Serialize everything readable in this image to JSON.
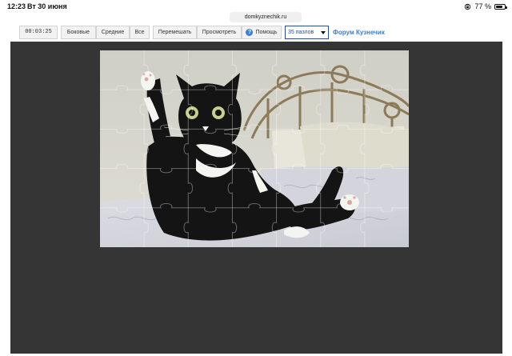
{
  "status_bar": {
    "time": "12:23",
    "date": "Вт 30 июня",
    "battery": "77 %",
    "battery_level": 0.77
  },
  "browser": {
    "url": "domkyznechik.ru"
  },
  "toolbar": {
    "timer": "00:03:25",
    "sides_label": "Боковые",
    "middle_label": "Средние",
    "all_label": "Все",
    "shuffle_label": "Перемешать",
    "preview_label": "Просмотреть",
    "help_label": "Помощь",
    "pieces_selected": "35 пазлов",
    "forum_link": "Форум Кузнечик"
  },
  "colors": {
    "board_bg": "#353535",
    "link": "#3b7fd6",
    "select_border": "#2b4f86"
  },
  "puzzle": {
    "rows": 5,
    "cols": 7,
    "image_subject": "black-and-white cat sitting on bed"
  }
}
